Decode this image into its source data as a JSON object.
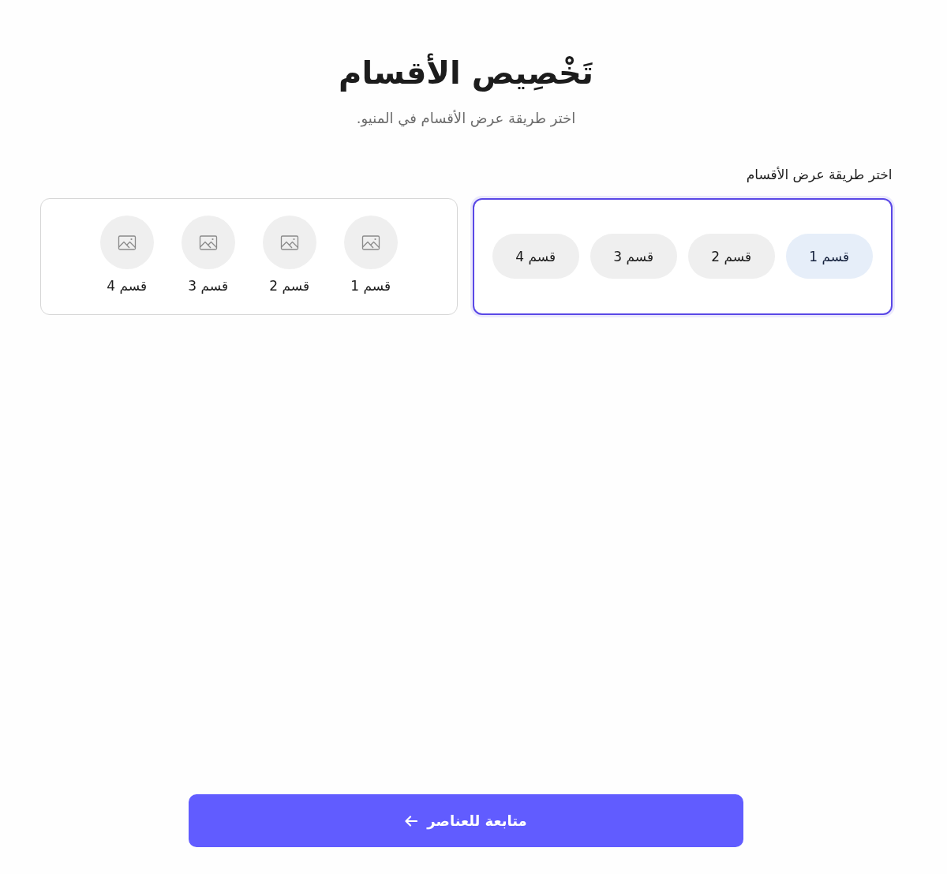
{
  "header": {
    "title": "تَخْصِيص الأقسام",
    "subtitle": "اختر طريقة عرض الأقسام في المنيو."
  },
  "layout_picker": {
    "label": "اختر طريقة عرض الأقسام",
    "options": [
      {
        "kind": "pills",
        "selected": true,
        "items": [
          {
            "label": "قسم 1",
            "selected": true
          },
          {
            "label": "قسم 2",
            "selected": false
          },
          {
            "label": "قسم 3",
            "selected": false
          },
          {
            "label": "قسم 4",
            "selected": false
          }
        ]
      },
      {
        "kind": "circles",
        "selected": false,
        "items": [
          {
            "label": "قسم 1"
          },
          {
            "label": "قسم 2"
          },
          {
            "label": "قسم 3"
          },
          {
            "label": "قسم 4"
          }
        ]
      }
    ]
  },
  "continue_button": {
    "label": "متابعة للعناصر"
  }
}
